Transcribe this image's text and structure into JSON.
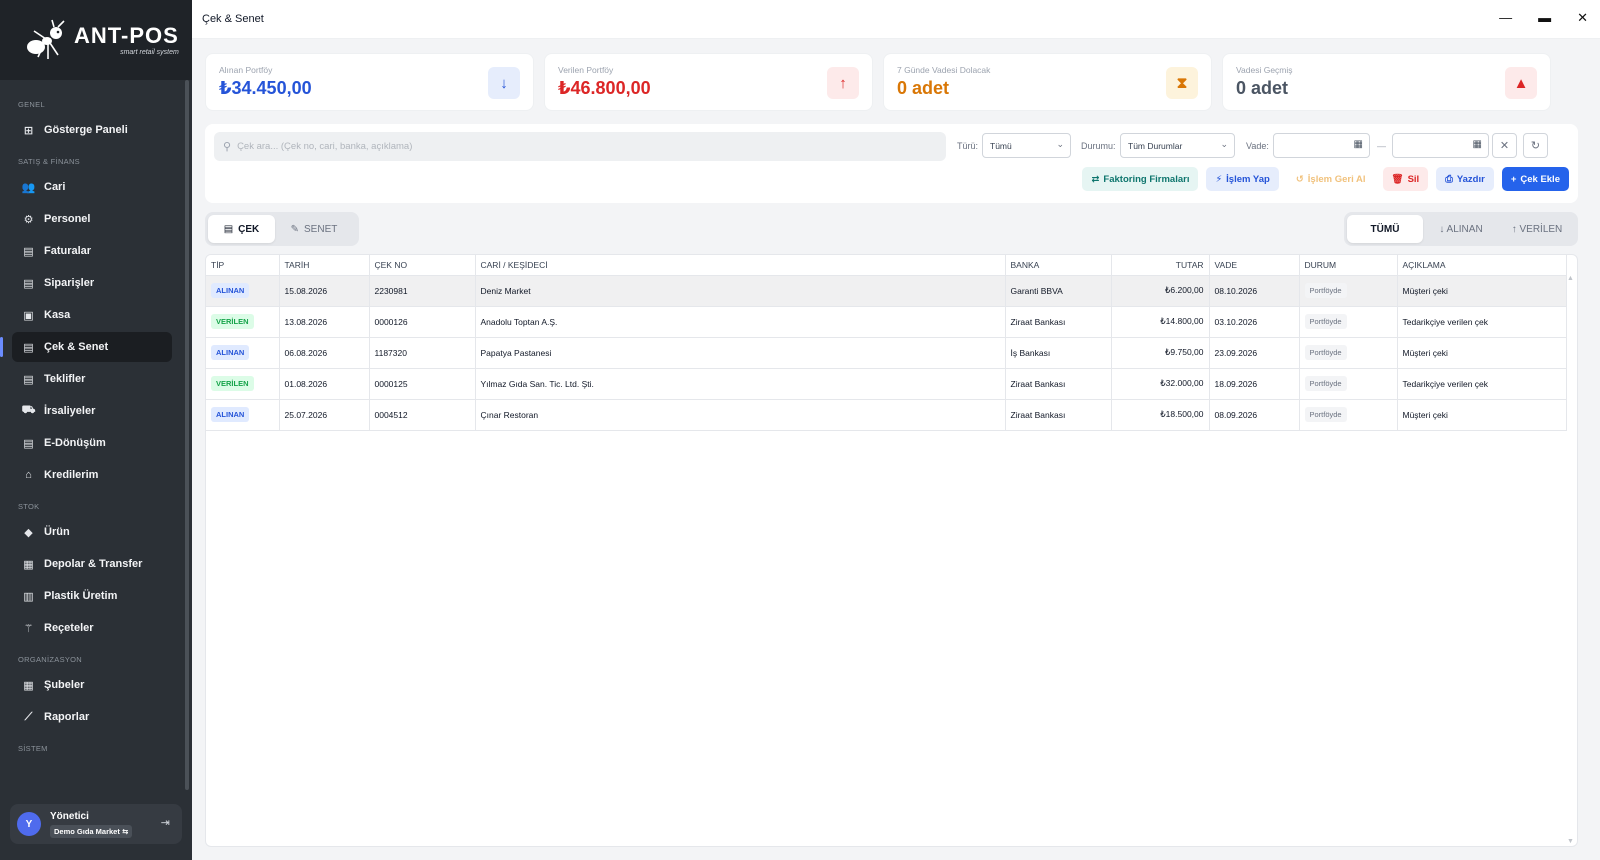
{
  "app": {
    "logo_title": "ANT-POS",
    "logo_sub": "smart retail system",
    "window_title": "Çek & Senet"
  },
  "sidebar": {
    "sections": [
      {
        "title": "GENEL",
        "items": [
          {
            "label": "Gösterge Paneli",
            "icon": "dashboard-icon"
          }
        ]
      },
      {
        "title": "SATIŞ & FİNANS",
        "items": [
          {
            "label": "Cari",
            "icon": "users-icon"
          },
          {
            "label": "Personel",
            "icon": "user-gear-icon"
          },
          {
            "label": "Faturalar",
            "icon": "invoice-icon"
          },
          {
            "label": "Siparişler",
            "icon": "order-icon"
          },
          {
            "label": "Kasa",
            "icon": "wallet-icon"
          },
          {
            "label": "Çek & Senet",
            "icon": "check-icon",
            "active": true
          },
          {
            "label": "Teklifler",
            "icon": "offer-icon"
          },
          {
            "label": "İrsaliyeler",
            "icon": "truck-icon"
          },
          {
            "label": "E-Dönüşüm",
            "icon": "e-document-icon"
          },
          {
            "label": "Kredilerim",
            "icon": "bank-icon"
          }
        ]
      },
      {
        "title": "STOK",
        "items": [
          {
            "label": "Ürün",
            "icon": "tag-icon"
          },
          {
            "label": "Depolar & Transfer",
            "icon": "warehouse-icon"
          },
          {
            "label": "Plastik Üretim",
            "icon": "factory-icon"
          },
          {
            "label": "Reçeteler",
            "icon": "utensils-icon"
          }
        ]
      },
      {
        "title": "ORGANİZASYON",
        "items": [
          {
            "label": "Şubeler",
            "icon": "branch-icon"
          },
          {
            "label": "Raporlar",
            "icon": "chart-line-icon"
          }
        ]
      },
      {
        "title": "SİSTEM",
        "items": []
      }
    ],
    "user": {
      "initial": "Y",
      "name": "Yönetici",
      "branch": "Demo Gıda Market",
      "branch_icon": "⇆"
    }
  },
  "cards": [
    {
      "label": "Alınan Portföy",
      "value": "₺34.450,00",
      "color": "#2554d8",
      "icon": "↓",
      "icon_name": "arrow-down-icon",
      "icon_bg": "#e6edfc",
      "icon_color": "#2554d8"
    },
    {
      "label": "Verilen Portföy",
      "value": "₺46.800,00",
      "color": "#dc2626",
      "icon": "↑",
      "icon_name": "arrow-up-icon",
      "icon_bg": "#fdeaea",
      "icon_color": "#dc2626"
    },
    {
      "label": "7 Günde Vadesi Dolacak",
      "value": "0 adet",
      "color": "#d97706",
      "icon": "⧗",
      "icon_name": "hourglass-icon",
      "icon_bg": "#fdf3dc",
      "icon_color": "#d97706"
    },
    {
      "label": "Vadesi Geçmiş",
      "value": "0 adet",
      "color": "#4b5563",
      "icon": "▲",
      "icon_name": "warning-icon",
      "icon_bg": "#fdeaea",
      "icon_color": "#dc2626"
    }
  ],
  "filters": {
    "search_placeholder": "Çek ara... (Çek no, cari, banka, açıklama)",
    "type_label": "Türü:",
    "type_value": "Tümü",
    "status_label": "Durumu:",
    "status_value": "Tüm Durumlar",
    "due_label": "Vade:",
    "date_sep": "—"
  },
  "actions": [
    {
      "label": "Faktoring Firmaları",
      "icon": "⇄",
      "icon_name": "factoring-icon",
      "bg": "#e6f5f3",
      "color": "#0f766e"
    },
    {
      "label": "İşlem Yap",
      "icon": "⚡",
      "icon_name": "bolt-icon",
      "bg": "#e6edfc",
      "color": "#2554d8"
    },
    {
      "label": "İşlem Geri Al",
      "icon": "↺",
      "icon_name": "undo-icon",
      "bg": "#fff",
      "color": "#f1c27d"
    },
    {
      "label": "Sil",
      "icon": "🗑",
      "icon_name": "trash-icon",
      "bg": "#fdeaea",
      "color": "#dc2626"
    },
    {
      "label": "Yazdır",
      "icon": "⎙",
      "icon_name": "print-icon",
      "bg": "#e6edfc",
      "color": "#2554d8"
    },
    {
      "label": "Çek Ekle",
      "icon": "+",
      "icon_name": "plus-icon",
      "bg": "#2563eb",
      "color": "#ffffff"
    }
  ],
  "doc_tabs": [
    {
      "label": "ÇEK",
      "icon": "▤",
      "active": true
    },
    {
      "label": "SENET",
      "icon": "✎",
      "active": false
    }
  ],
  "dir_tabs": [
    {
      "label": "TÜMÜ",
      "active": true
    },
    {
      "label": "↓ ALINAN",
      "active": false
    },
    {
      "label": "↑ VERİLEN",
      "active": false
    }
  ],
  "table": {
    "columns": [
      "TİP",
      "TARİH",
      "ÇEK NO",
      "CARİ / KEŞİDECİ",
      "BANKA",
      "TUTAR",
      "VADE",
      "DURUM",
      "AÇIKLAMA"
    ],
    "rows": [
      {
        "type": "ALINAN",
        "date": "15.08.2026",
        "no": "2230981",
        "party": "Deniz Market",
        "bank": "Garanti BBVA",
        "amount": "₺6.200,00",
        "due": "08.10.2026",
        "status": "Portföyde",
        "desc": "Müşteri çeki",
        "selected": true
      },
      {
        "type": "VERİLEN",
        "date": "13.08.2026",
        "no": "0000126",
        "party": "Anadolu Toptan A.Ş.",
        "bank": "Ziraat Bankası",
        "amount": "₺14.800,00",
        "due": "03.10.2026",
        "status": "Portföyde",
        "desc": "Tedarikçiye verilen çek"
      },
      {
        "type": "ALINAN",
        "date": "06.08.2026",
        "no": "1187320",
        "party": "Papatya Pastanesi",
        "bank": "İş Bankası",
        "amount": "₺9.750,00",
        "due": "23.09.2026",
        "status": "Portföyde",
        "desc": "Müşteri çeki"
      },
      {
        "type": "VERİLEN",
        "date": "01.08.2026",
        "no": "0000125",
        "party": "Yılmaz Gıda San. Tic. Ltd. Şti.",
        "bank": "Ziraat Bankası",
        "amount": "₺32.000,00",
        "due": "18.09.2026",
        "status": "Portföyde",
        "desc": "Tedarikçiye verilen çek"
      },
      {
        "type": "ALINAN",
        "date": "25.07.2026",
        "no": "0004512",
        "party": "Çınar Restoran",
        "bank": "Ziraat Bankası",
        "amount": "₺18.500,00",
        "due": "08.09.2026",
        "status": "Portföyde",
        "desc": "Müşteri çeki"
      }
    ]
  }
}
